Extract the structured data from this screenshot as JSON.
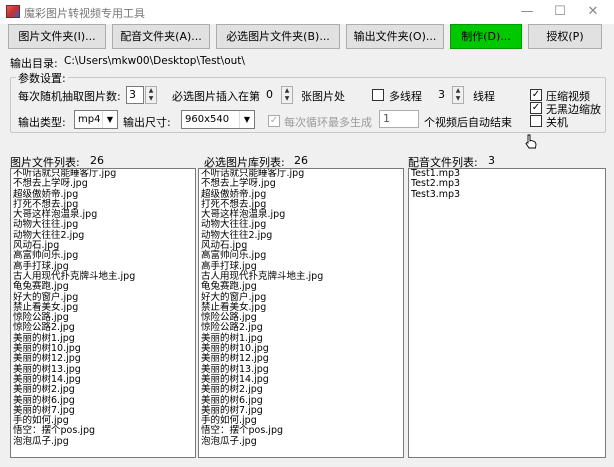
{
  "window": {
    "title": "魔彩图片转视频专用工具",
    "icons": {
      "app": "app-logo-icon",
      "minimize": "minimize-icon",
      "maximize": "maximize-icon",
      "close": "close-icon"
    }
  },
  "toolbar": {
    "image_folder": "图片文件夹(I)...",
    "audio_folder": "配音文件夹(A)...",
    "required_image_folder": "必选图片文件夹(B)...",
    "output_folder": "输出文件夹(O)...",
    "make": "制作(D)...",
    "license": "授权(P)"
  },
  "output_dir": {
    "label": "输出目录:",
    "value": "C:\\Users\\mkw00\\Desktop\\Test\\out\\"
  },
  "params": {
    "group_title": "参数设置:",
    "random_count_label": "每次随机抽取图片数:",
    "random_count_value": "3",
    "required_insert_label": "必选图片插入在第",
    "required_insert_value": "0",
    "required_insert_suffix": "张图片处",
    "multithread_label": "多线程",
    "multithread_checked": false,
    "threads_value": "3",
    "threads_label": "线程",
    "compress_label": "压缩视频",
    "compress_checked": true,
    "no_black_border_label": "无黑边缩放",
    "no_black_border_checked": true,
    "shutdown_label": "关机",
    "shutdown_checked": false,
    "output_type_label": "输出类型:",
    "output_type_value": "mp4",
    "output_size_label": "输出尺寸:",
    "output_size_value": "960x540",
    "loop_label": "每次循环最多生成",
    "loop_checked": true,
    "loop_value": "1",
    "auto_stop_label": "个视频后自动结束"
  },
  "lists": {
    "images_label": "图片文件列表:",
    "images_count": "26",
    "required_label": "必选图片库列表:",
    "required_count": "26",
    "audio_label": "配音文件列表:",
    "audio_count": "3",
    "images": [
      "不听话就只能睡客厅.jpg",
      "不想去上学呀.jpg",
      "超级傲娇帝.jpg",
      "打死不想去.jpg",
      "大哥这样泡温泉.jpg",
      "动物大往往.jpg",
      "动物大往往2.jpg",
      "风动石.jpg",
      "高富帅问乐.jpg",
      "高手打球.jpg",
      "古人用现代扑克牌斗地主.jpg",
      "龟兔赛跑.jpg",
      "好大的窗户.jpg",
      "禁止看美女.jpg",
      "惊险公路.jpg",
      "惊险公路2.jpg",
      "美丽的树1.jpg",
      "美丽的树10.jpg",
      "美丽的树12.jpg",
      "美丽的树13.jpg",
      "美丽的树14.jpg",
      "美丽的树2.jpg",
      "美丽的树6.jpg",
      "美丽的树7.jpg",
      "手的如何.jpg",
      "悟空：摆个pos.jpg",
      "泡泡瓜子.jpg"
    ],
    "required": [
      "不听话就只能睡客厅.jpg",
      "不想去上学呀.jpg",
      "超级傲娇帝.jpg",
      "打死不想去.jpg",
      "大哥这样泡温泉.jpg",
      "动物大往往.jpg",
      "动物大往往2.jpg",
      "风动石.jpg",
      "高富帅问乐.jpg",
      "高手打球.jpg",
      "古人用现代扑克牌斗地主.jpg",
      "龟兔赛跑.jpg",
      "好大的窗户.jpg",
      "禁止看美女.jpg",
      "惊险公路.jpg",
      "惊险公路2.jpg",
      "美丽的树1.jpg",
      "美丽的树10.jpg",
      "美丽的树12.jpg",
      "美丽的树13.jpg",
      "美丽的树14.jpg",
      "美丽的树2.jpg",
      "美丽的树6.jpg",
      "美丽的树7.jpg",
      "手的如何.jpg",
      "悟空：摆个pos.jpg",
      "泡泡瓜子.jpg"
    ],
    "audio": [
      "Test1.mp3",
      "Test2.mp3",
      "Test3.mp3"
    ]
  }
}
